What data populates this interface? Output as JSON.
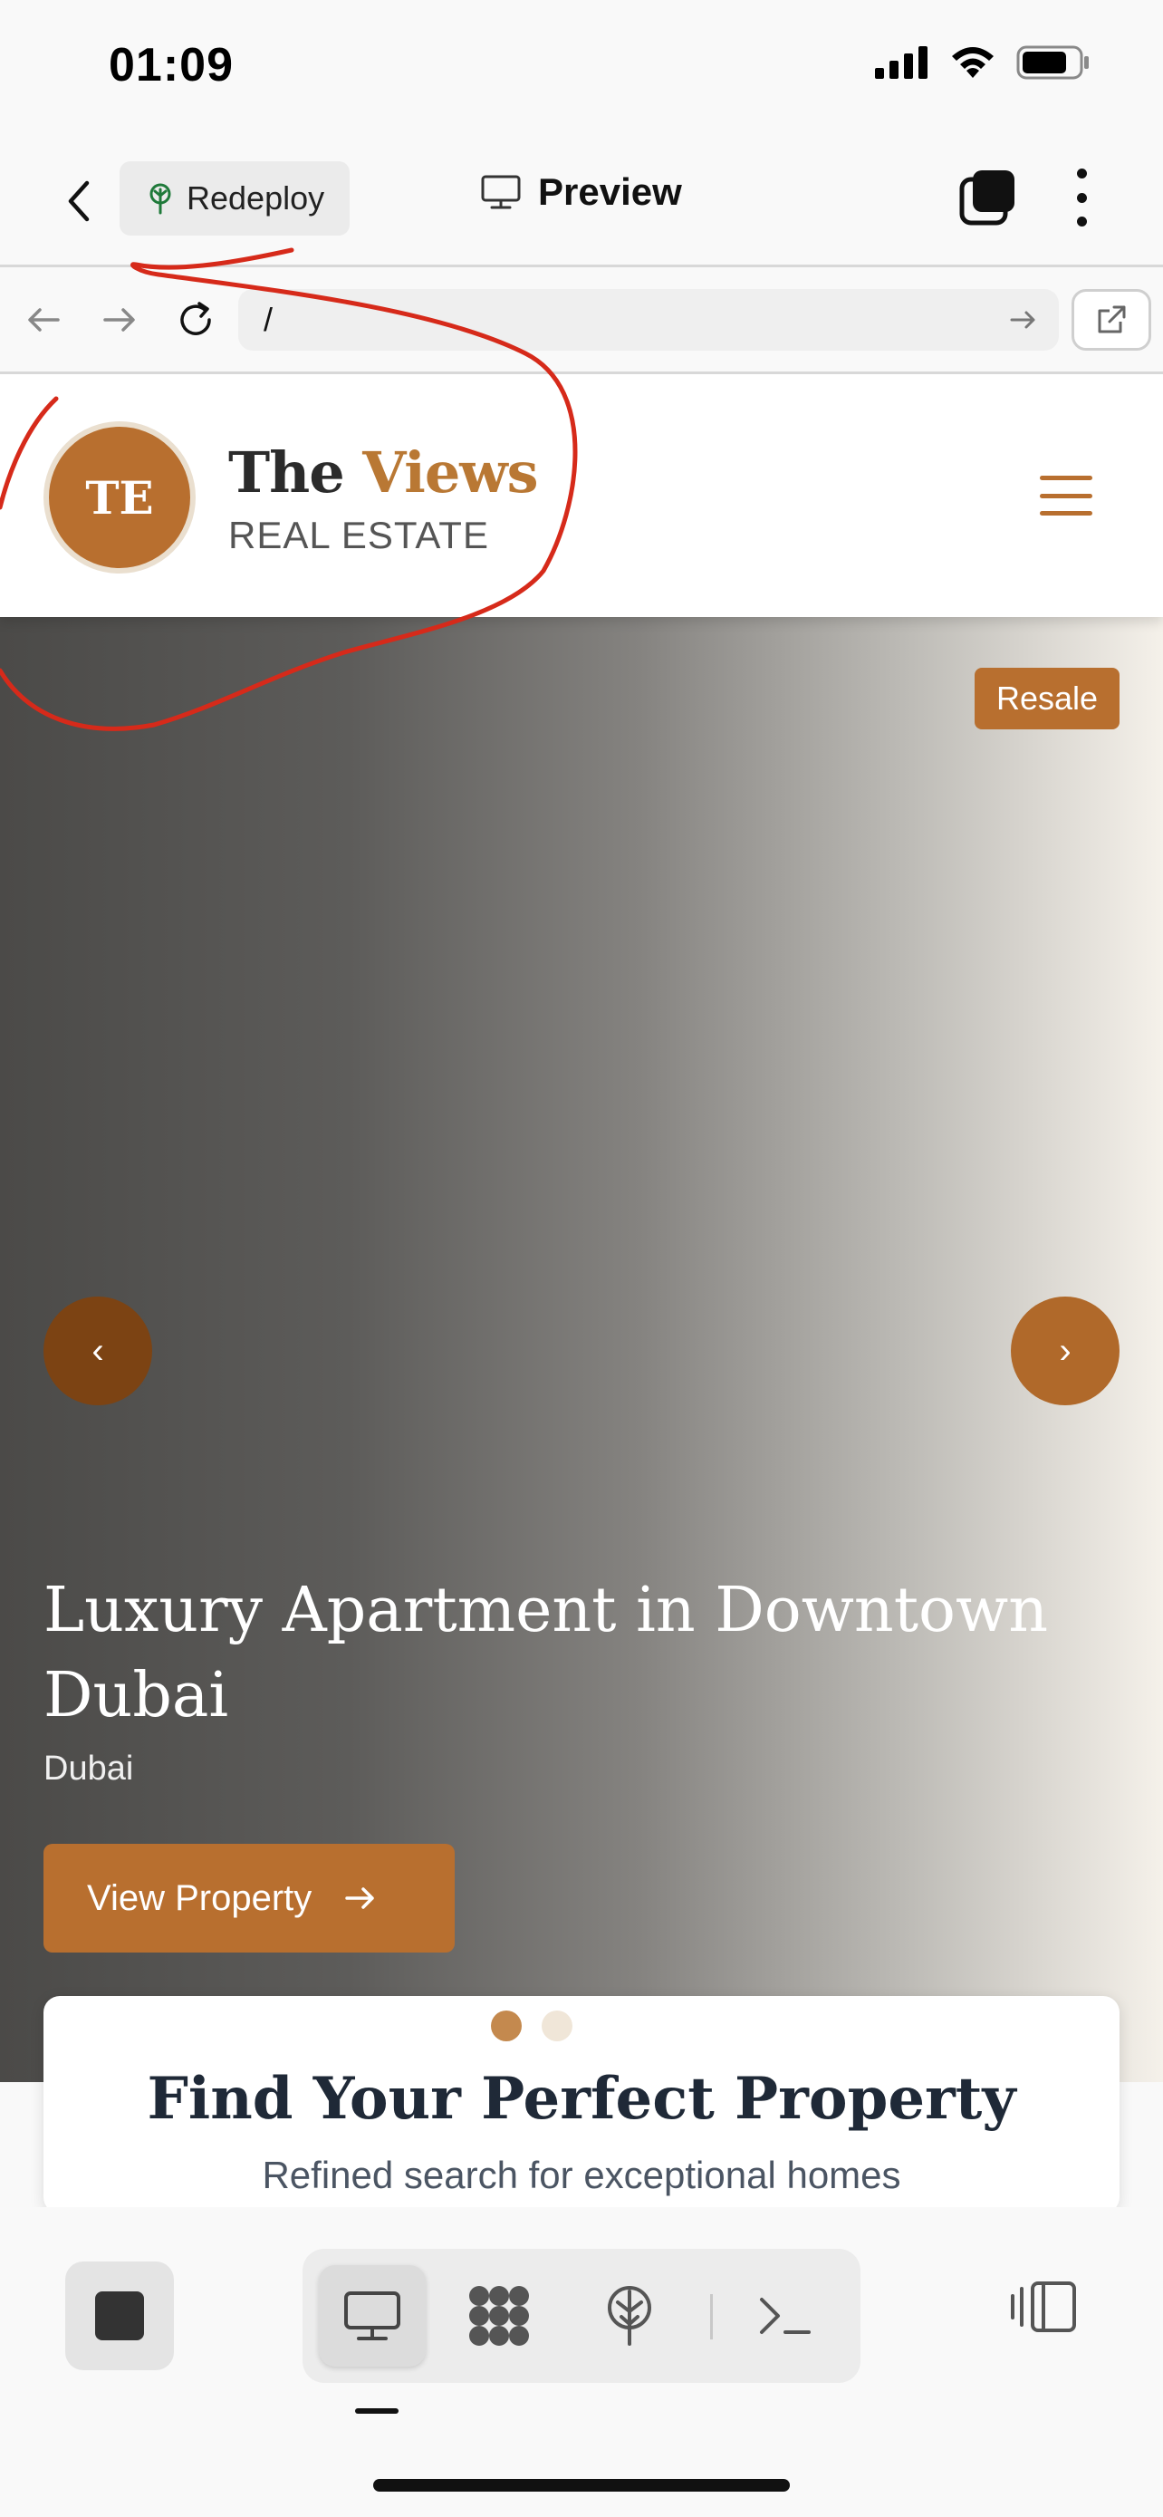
{
  "status_bar": {
    "time": "01:09"
  },
  "app_header": {
    "redeploy_label": "Redeploy",
    "title": "Preview"
  },
  "browser": {
    "url": "/"
  },
  "site": {
    "logo_initials": "TE",
    "brand_part1": "The ",
    "brand_part2": "Views",
    "brand_sub": "REAL ESTATE",
    "hero": {
      "tag": "Resale",
      "prev": "‹",
      "next": "›",
      "title": "Luxury Apartment in Downtown Dubai",
      "location": "Dubai",
      "cta": "View Property"
    },
    "search": {
      "title": "Find Your Perfect Property",
      "subtitle": "Refined search for exceptional homes"
    },
    "carousel": {
      "slides": 2,
      "active_index": 0
    }
  },
  "colors": {
    "accent": "#b86f2f",
    "annotation": "#d62a1a"
  },
  "icons": {
    "status": [
      "signal-icon",
      "wifi-icon",
      "battery-icon"
    ],
    "bottom_tools": [
      "desktop-icon",
      "components-icon",
      "deploy-icon",
      "terminal-icon"
    ]
  }
}
